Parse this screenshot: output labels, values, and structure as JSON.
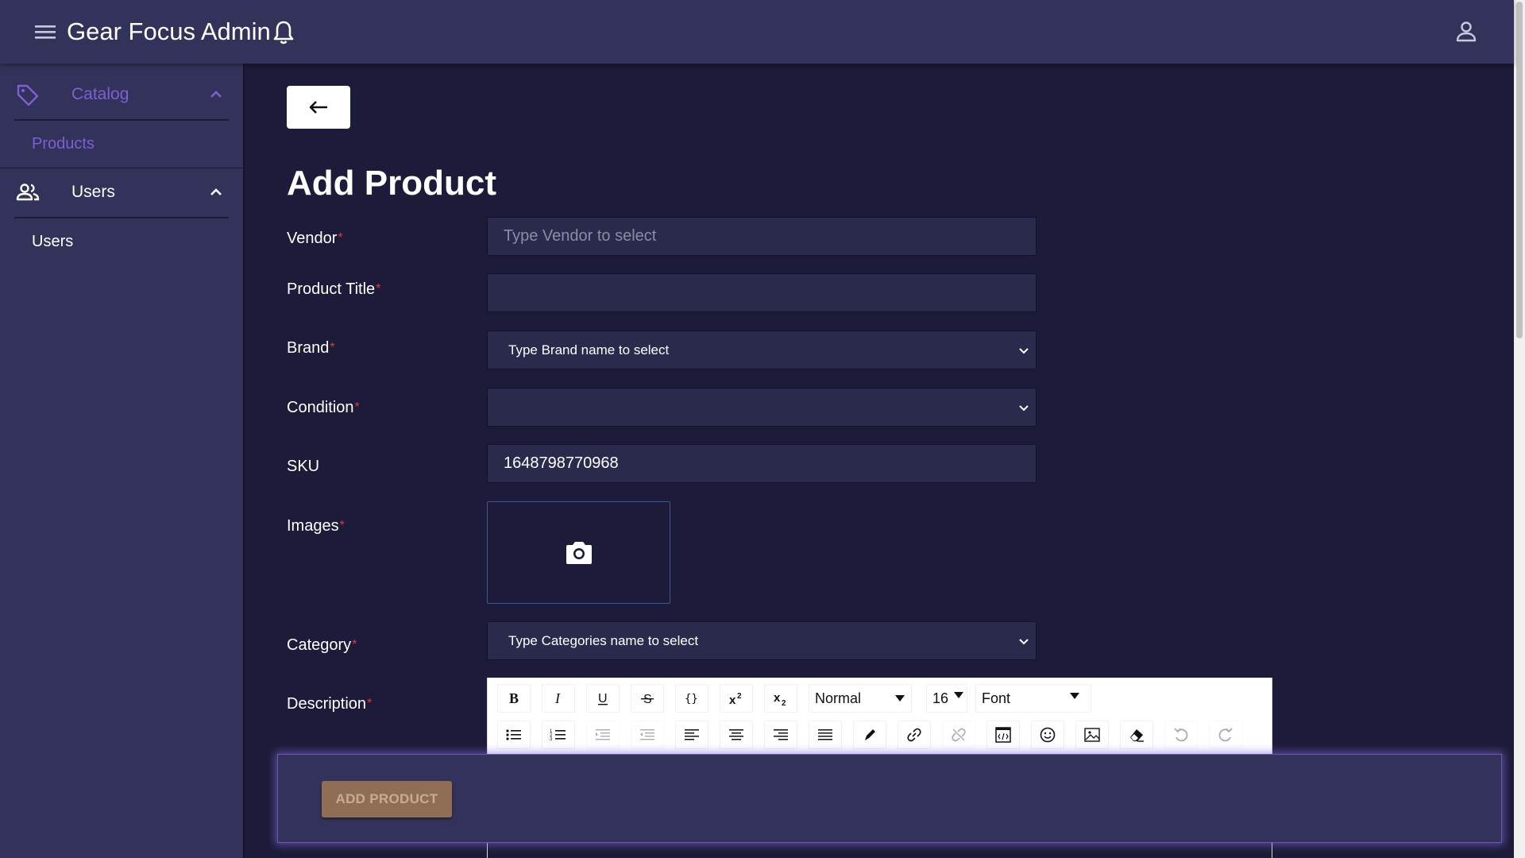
{
  "app": {
    "title": "Gear Focus Admin"
  },
  "sidebar": {
    "groups": [
      {
        "label": "Catalog",
        "items": [
          {
            "label": "Products"
          }
        ]
      },
      {
        "label": "Users",
        "items": [
          {
            "label": "Users"
          }
        ]
      }
    ]
  },
  "page": {
    "title": "Add Product"
  },
  "form": {
    "vendor": {
      "label": "Vendor",
      "placeholder": "Type Vendor to select",
      "value": ""
    },
    "product_title": {
      "label": "Product Title",
      "value": ""
    },
    "brand": {
      "label": "Brand",
      "selected": "Type Brand name to select"
    },
    "condition": {
      "label": "Condition",
      "selected": ""
    },
    "sku": {
      "label": "SKU",
      "value": "1648798770968"
    },
    "images": {
      "label": "Images"
    },
    "category": {
      "label": "Category",
      "selected": "Type Categories name to select"
    },
    "description": {
      "label": "Description"
    },
    "required_mark": "*"
  },
  "editor": {
    "block_type": "Normal",
    "font_size": "16",
    "font_family": "Font"
  },
  "footer": {
    "submit_label": "ADD PRODUCT"
  },
  "colors": {
    "background": "#1c1b39",
    "appbar": "#33325a",
    "sidebar_active": "#7e5fd6",
    "required": "#e53935",
    "submit_button": "#8f6e55"
  }
}
